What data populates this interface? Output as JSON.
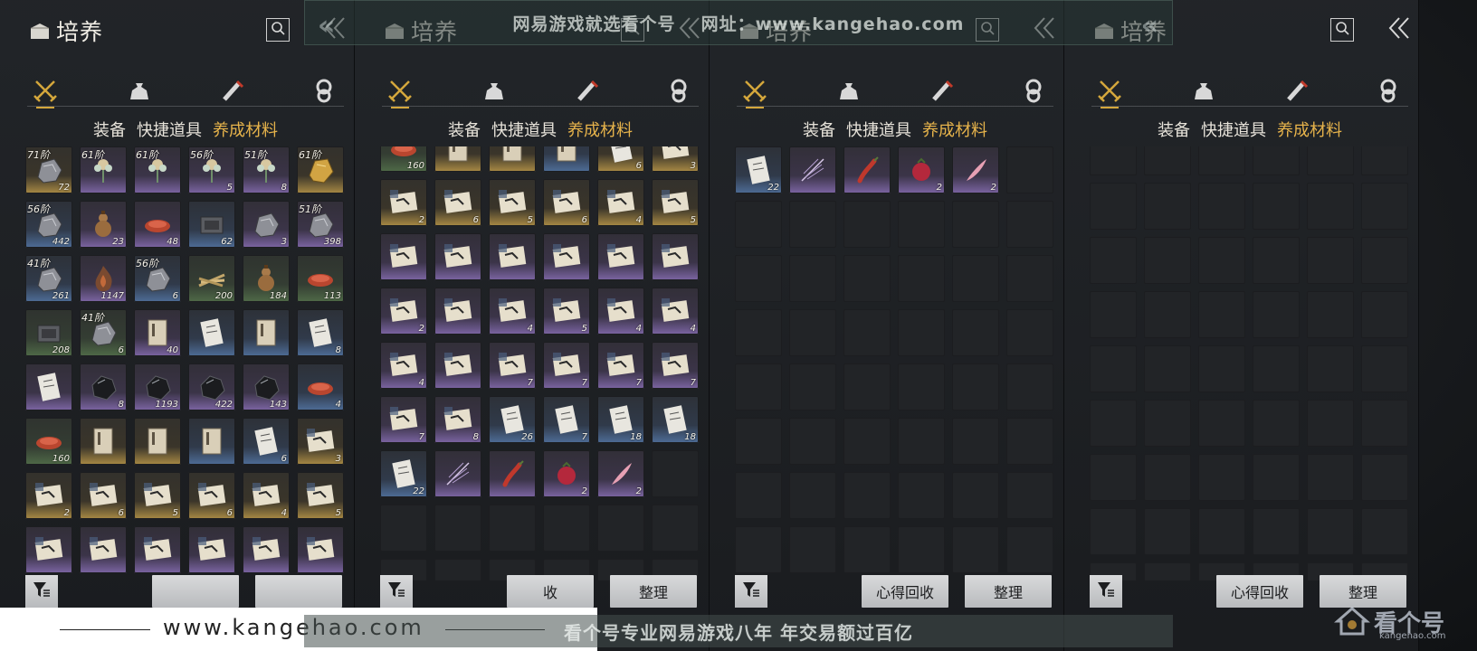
{
  "panels": [
    {
      "title": "培养",
      "filter_only": true,
      "buttons": [],
      "visible_buttons": []
    },
    {
      "title": "培养",
      "buttons": [
        "收",
        "整理"
      ]
    },
    {
      "title": "培养",
      "buttons": [
        "心得回收",
        "整理"
      ]
    },
    {
      "title": "培养",
      "buttons": [
        "心得回收",
        "整理"
      ]
    }
  ],
  "tabs": {
    "equip": "装备",
    "quick": "快捷道具",
    "material": "养成材料"
  },
  "category_icons": [
    "crossed-swords-icon",
    "pouch-icon",
    "scroll-icon",
    "gem-icon"
  ],
  "grid1": [
    {
      "grade": "71阶",
      "count": "72",
      "bg": "gold",
      "icon": "stone"
    },
    {
      "grade": "61阶",
      "count": "",
      "bg": "purple",
      "icon": "flower"
    },
    {
      "grade": "61阶",
      "count": "",
      "bg": "purple",
      "icon": "flower"
    },
    {
      "grade": "56阶",
      "count": "5",
      "bg": "purple",
      "icon": "flower"
    },
    {
      "grade": "51阶",
      "count": "8",
      "bg": "purple",
      "icon": "flower"
    },
    {
      "grade": "61阶",
      "count": "",
      "bg": "gold",
      "icon": "gold-ore"
    },
    {
      "grade": "56阶",
      "count": "442",
      "bg": "blue",
      "icon": "stone"
    },
    {
      "grade": "",
      "count": "23",
      "bg": "purple",
      "icon": "gourd"
    },
    {
      "grade": "",
      "count": "48",
      "bg": "purple",
      "icon": "dish"
    },
    {
      "grade": "",
      "count": "62",
      "bg": "blue",
      "icon": "box"
    },
    {
      "grade": "",
      "count": "3",
      "bg": "purple",
      "icon": "stone"
    },
    {
      "grade": "51阶",
      "count": "398",
      "bg": "purple",
      "icon": "stone"
    },
    {
      "grade": "41阶",
      "count": "261",
      "bg": "blue",
      "icon": "stone"
    },
    {
      "grade": "",
      "count": "1147",
      "bg": "purple",
      "icon": "fire"
    },
    {
      "grade": "56阶",
      "count": "6",
      "bg": "blue",
      "icon": "stone"
    },
    {
      "grade": "",
      "count": "200",
      "bg": "green",
      "icon": "sticks"
    },
    {
      "grade": "",
      "count": "184",
      "bg": "green",
      "icon": "gourd"
    },
    {
      "grade": "",
      "count": "113",
      "bg": "green",
      "icon": "dish"
    },
    {
      "grade": "",
      "count": "208",
      "bg": "green",
      "icon": "box"
    },
    {
      "grade": "41阶",
      "count": "6",
      "bg": "green",
      "icon": "stone"
    },
    {
      "grade": "",
      "count": "40",
      "bg": "purple",
      "icon": "book"
    },
    {
      "grade": "",
      "count": "",
      "bg": "blue",
      "icon": "paper"
    },
    {
      "grade": "",
      "count": "",
      "bg": "blue",
      "icon": "book"
    },
    {
      "grade": "",
      "count": "8",
      "bg": "blue",
      "icon": "paper"
    },
    {
      "grade": "",
      "count": "",
      "bg": "purple",
      "icon": "paper"
    },
    {
      "grade": "",
      "count": "8",
      "bg": "purple",
      "icon": "black-stone"
    },
    {
      "grade": "",
      "count": "1193",
      "bg": "purple",
      "icon": "black-stone"
    },
    {
      "grade": "",
      "count": "422",
      "bg": "purple",
      "icon": "black-stone"
    },
    {
      "grade": "",
      "count": "143",
      "bg": "purple",
      "icon": "black-stone"
    },
    {
      "grade": "",
      "count": "4",
      "bg": "blue",
      "icon": "dish"
    },
    {
      "grade": "",
      "count": "160",
      "bg": "green",
      "icon": "dish"
    },
    {
      "grade": "",
      "count": "",
      "bg": "gold",
      "icon": "book"
    },
    {
      "grade": "",
      "count": "",
      "bg": "gold",
      "icon": "book"
    },
    {
      "grade": "",
      "count": "",
      "bg": "blue",
      "icon": "book"
    },
    {
      "grade": "",
      "count": "6",
      "bg": "blue",
      "icon": "paper"
    },
    {
      "grade": "",
      "count": "3",
      "bg": "gold",
      "icon": "scroll"
    },
    {
      "grade": "",
      "count": "2",
      "bg": "gold",
      "icon": "scroll"
    },
    {
      "grade": "",
      "count": "6",
      "bg": "gold",
      "icon": "scroll"
    },
    {
      "grade": "",
      "count": "5",
      "bg": "gold",
      "icon": "scroll"
    },
    {
      "grade": "",
      "count": "6",
      "bg": "gold",
      "icon": "scroll"
    },
    {
      "grade": "",
      "count": "4",
      "bg": "gold",
      "icon": "scroll"
    },
    {
      "grade": "",
      "count": "5",
      "bg": "gold",
      "icon": "scroll"
    },
    {
      "grade": "",
      "count": "",
      "bg": "purple",
      "icon": "scroll"
    },
    {
      "grade": "",
      "count": "",
      "bg": "purple",
      "icon": "scroll"
    },
    {
      "grade": "",
      "count": "",
      "bg": "purple",
      "icon": "scroll"
    },
    {
      "grade": "",
      "count": "",
      "bg": "purple",
      "icon": "scroll"
    },
    {
      "grade": "",
      "count": "",
      "bg": "purple",
      "icon": "scroll"
    },
    {
      "grade": "",
      "count": "",
      "bg": "purple",
      "icon": "scroll"
    }
  ],
  "grid2": [
    {
      "count": "160",
      "bg": "green",
      "icon": "dish"
    },
    {
      "count": "",
      "bg": "gold",
      "icon": "book"
    },
    {
      "count": "",
      "bg": "gold",
      "icon": "book"
    },
    {
      "count": "",
      "bg": "blue",
      "icon": "book"
    },
    {
      "count": "6",
      "bg": "gold",
      "icon": "paper"
    },
    {
      "count": "3",
      "bg": "gold",
      "icon": "scroll"
    },
    {
      "count": "2",
      "bg": "gold",
      "icon": "scroll"
    },
    {
      "count": "6",
      "bg": "gold",
      "icon": "scroll"
    },
    {
      "count": "5",
      "bg": "gold",
      "icon": "scroll"
    },
    {
      "count": "6",
      "bg": "gold",
      "icon": "scroll"
    },
    {
      "count": "4",
      "bg": "gold",
      "icon": "scroll"
    },
    {
      "count": "5",
      "bg": "gold",
      "icon": "scroll"
    },
    {
      "count": "",
      "bg": "purple",
      "icon": "scroll"
    },
    {
      "count": "",
      "bg": "purple",
      "icon": "scroll"
    },
    {
      "count": "",
      "bg": "purple",
      "icon": "scroll"
    },
    {
      "count": "",
      "bg": "purple",
      "icon": "scroll"
    },
    {
      "count": "",
      "bg": "purple",
      "icon": "scroll"
    },
    {
      "count": "",
      "bg": "purple",
      "icon": "scroll"
    },
    {
      "count": "2",
      "bg": "purple",
      "icon": "scroll"
    },
    {
      "count": "",
      "bg": "purple",
      "icon": "scroll"
    },
    {
      "count": "4",
      "bg": "purple",
      "icon": "scroll"
    },
    {
      "count": "5",
      "bg": "purple",
      "icon": "scroll"
    },
    {
      "count": "4",
      "bg": "purple",
      "icon": "scroll"
    },
    {
      "count": "4",
      "bg": "purple",
      "icon": "scroll"
    },
    {
      "count": "4",
      "bg": "purple",
      "icon": "scroll"
    },
    {
      "count": "",
      "bg": "purple",
      "icon": "scroll"
    },
    {
      "count": "7",
      "bg": "purple",
      "icon": "scroll"
    },
    {
      "count": "7",
      "bg": "purple",
      "icon": "scroll"
    },
    {
      "count": "7",
      "bg": "purple",
      "icon": "scroll"
    },
    {
      "count": "7",
      "bg": "purple",
      "icon": "scroll"
    },
    {
      "count": "7",
      "bg": "purple",
      "icon": "scroll"
    },
    {
      "count": "8",
      "bg": "purple",
      "icon": "scroll"
    },
    {
      "count": "26",
      "bg": "blue",
      "icon": "paper"
    },
    {
      "count": "7",
      "bg": "blue",
      "icon": "paper"
    },
    {
      "count": "18",
      "bg": "blue",
      "icon": "paper"
    },
    {
      "count": "18",
      "bg": "blue",
      "icon": "paper"
    },
    {
      "count": "22",
      "bg": "blue",
      "icon": "paper"
    },
    {
      "count": "",
      "bg": "purple",
      "icon": "feather"
    },
    {
      "count": "",
      "bg": "purple",
      "icon": "pepper"
    },
    {
      "count": "2",
      "bg": "purple",
      "icon": "berry"
    },
    {
      "count": "2",
      "bg": "purple",
      "icon": "feather2"
    }
  ],
  "grid3": [
    {
      "count": "22",
      "bg": "blue",
      "icon": "paper"
    },
    {
      "count": "",
      "bg": "purple",
      "icon": "feather"
    },
    {
      "count": "",
      "bg": "purple",
      "icon": "pepper"
    },
    {
      "count": "2",
      "bg": "purple",
      "icon": "berry"
    },
    {
      "count": "2",
      "bg": "purple",
      "icon": "feather2"
    }
  ],
  "watermark": {
    "top_text": "网易游戏就选看个号",
    "top_url": "网址：www.kangehao.com",
    "bottom_url": "www.kangehao.com",
    "bottom_slogan": "看个号专业网易游戏八年 年交易额过百亿",
    "logo_text": "看个号",
    "logo_url": "kangehao.com"
  },
  "colors": {
    "accent": "#e6b34b",
    "tab_text": "#e7e3da",
    "panel_bg": "#222529"
  }
}
